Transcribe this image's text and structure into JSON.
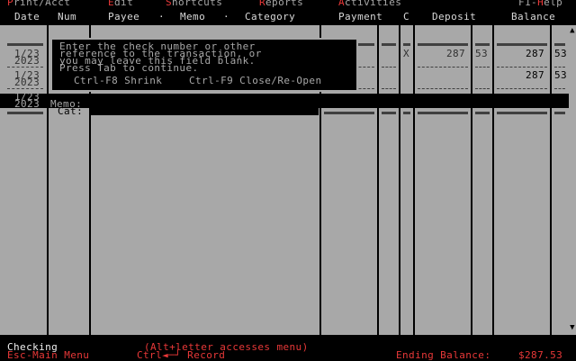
{
  "menubar": {
    "items": [
      {
        "hot": "P",
        "rest": "rint/Acct"
      },
      {
        "hot": "E",
        "rest": "dit"
      },
      {
        "hot": "S",
        "rest": "hortcuts"
      },
      {
        "hot": "R",
        "rest": "eports"
      },
      {
        "hot": "A",
        "rest": "ctivities"
      }
    ],
    "help": {
      "rest": "F1-",
      "hot": "H",
      "tail": "elp"
    }
  },
  "columns": {
    "date": "Date",
    "num": "Num",
    "payee": "Payee",
    "sep1": "·",
    "memo": "Memo",
    "sep2": "·",
    "category": "Category",
    "payment": "Payment",
    "cleared": "C",
    "deposit": "Deposit",
    "balance": "Balance"
  },
  "register": {
    "rows": [
      {
        "date_line1": "1/23",
        "date_line2": "2023",
        "cleared": "X",
        "deposit_dollars": "287",
        "deposit_cents": "53",
        "balance_dollars": "287",
        "balance_cents": "53"
      },
      {
        "date_line1": "1/23",
        "date_line2": "2023",
        "balance_dollars": "287",
        "balance_cents": "53"
      }
    ],
    "selected": {
      "date_line1": "1/23",
      "date_line2": "2023",
      "memo_label": "Memo:",
      "cat_label": "Cat:"
    }
  },
  "popup": {
    "lines": [
      "Enter the check number or other",
      "reference to the transaction, or",
      "you may leave this field blank.",
      "Press Tab to continue."
    ],
    "shrink": "Ctrl-F8 Shrink",
    "close": "Ctrl-F9 Close/Re-Open"
  },
  "status": {
    "account": "Checking",
    "hint": "(Alt+letter accesses menu)",
    "esc": "Esc-Main Menu",
    "record": "Ctrl◄─┘ Record",
    "ending_label": "Ending Balance:",
    "ending_value": "$287.53"
  },
  "colors": {
    "background": "#000000",
    "grid": "#a8a8a8",
    "hotkey": "#e83838",
    "text": "#a8a8a8"
  }
}
